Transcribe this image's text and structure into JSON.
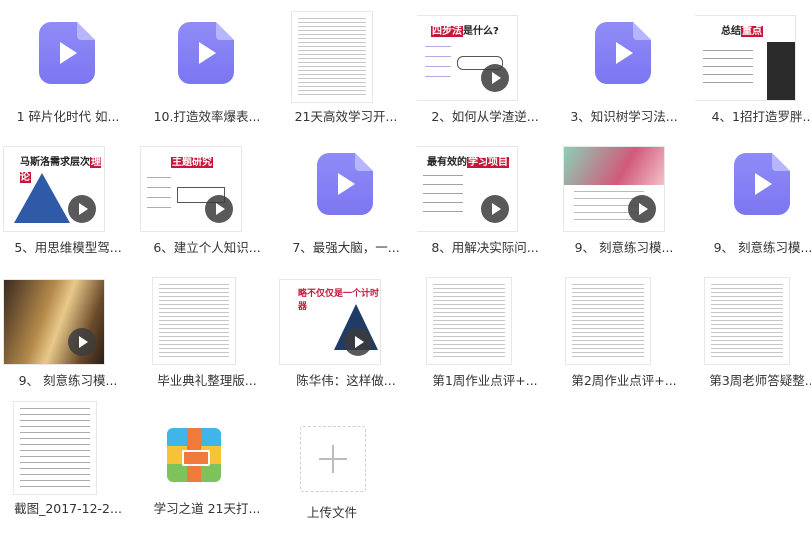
{
  "files": [
    {
      "label": "1 碎片化时代 如...",
      "kind": "video-file"
    },
    {
      "label": "10.打造效率爆表...",
      "kind": "video-file"
    },
    {
      "label": "21天高效学习开...",
      "kind": "doc"
    },
    {
      "label": "2、如何从学渣逆...",
      "kind": "video",
      "slide_text": "四步法是什么?",
      "slide_hl": "四步法"
    },
    {
      "label": "3、知识树学习法...",
      "kind": "video-file"
    },
    {
      "label": "4、1招打造罗胖...",
      "kind": "video",
      "slide_text": "总结",
      "slide_hl": "重点"
    },
    {
      "label": "5、用思维模型驾...",
      "kind": "video",
      "slide_text": "马斯洛需求层次",
      "slide_hl": "理论"
    },
    {
      "label": "6、建立个人知识...",
      "kind": "video",
      "slide_text": "主题研究",
      "slide_hl": ""
    },
    {
      "label": "7、最强大脑，一...",
      "kind": "video-file"
    },
    {
      "label": "8、用解决实际问...",
      "kind": "video",
      "slide_text": "最有效的",
      "slide_hl": "学习项目"
    },
    {
      "label": "9、 刻意练习模...",
      "kind": "video"
    },
    {
      "label": "9、 刻意练习模...",
      "kind": "video-file"
    },
    {
      "label": "9、 刻意练习模...",
      "kind": "video"
    },
    {
      "label": "毕业典礼整理版...",
      "kind": "doc"
    },
    {
      "label": "陈华伟：这样做...",
      "kind": "video",
      "slide_text": "略不仅仅是一个计时器",
      "slide_hl": ""
    },
    {
      "label": "第1周作业点评+...",
      "kind": "doc"
    },
    {
      "label": "第2周作业点评+...",
      "kind": "doc"
    },
    {
      "label": "第3周老师答疑整...",
      "kind": "doc"
    },
    {
      "label": "截图_2017-12-2...",
      "kind": "doc"
    },
    {
      "label": "学习之道 21天打...",
      "kind": "zip"
    }
  ],
  "upload": {
    "label": "上传文件"
  },
  "colors": {
    "file_icon": "#8480f5",
    "highlight": "#c8163a",
    "text": "#333333"
  }
}
